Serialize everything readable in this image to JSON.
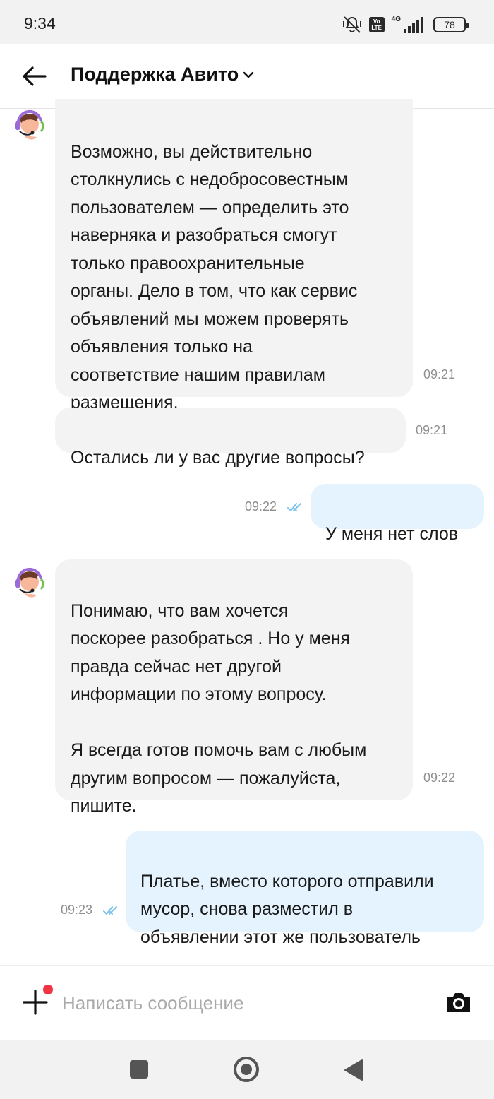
{
  "status_bar": {
    "time": "9:34",
    "network": "4G",
    "volte": "Vo\nLTE",
    "battery": "78",
    "icons": [
      "mute-vibrate-icon",
      "volte-icon",
      "signal-icon",
      "battery-icon"
    ]
  },
  "header": {
    "title": "Поддержка Авито",
    "back_icon": "arrow-left-icon",
    "dropdown_icon": "chevron-down-icon"
  },
  "messages": [
    {
      "direction": "incoming",
      "text": "Возможно, вы действительно\nстолкнулись с недобросовестным\nпользователем — определить это\nнаверняка и разобраться смогут\nтолько правоохранительные\nорганы. Дело в том, что как сервис\nобъявлений мы можем проверять\nобъявления  только на\nсоответствие нашим правилам\nразмещения.",
      "time": "09:21"
    },
    {
      "direction": "incoming",
      "text": "Остались ли у вас другие вопросы?",
      "time": "09:21"
    },
    {
      "direction": "outgoing",
      "text": "У меня нет слов",
      "time": "09:22",
      "status": "read"
    },
    {
      "direction": "incoming",
      "text": "Понимаю, что вам хочется\nпоскорее разобраться . Но у меня\nправда сейчас нет другой\nинформации по этому вопросу.\n\nЯ всегда готов помочь вам с любым\nдругим вопросом — пожалуйста,\nпишите.",
      "time": "09:22"
    },
    {
      "direction": "outgoing",
      "text": "Платье, вместо которого отправили\nмусор, снова разместил в\nобъявлении этот же пользователь",
      "time": "09:23",
      "status": "read"
    }
  ],
  "input": {
    "placeholder": "Написать сообщение",
    "value": "",
    "add_icon": "plus-icon",
    "camera_icon": "camera-icon"
  },
  "nav": {
    "icons": [
      "recents-icon",
      "home-icon",
      "back-icon"
    ]
  },
  "colors": {
    "incoming_bubble": "#f3f3f3",
    "outgoing_bubble": "#e4f3fd",
    "read_ticks": "#7cc4ee",
    "notification_dot": "#f23545"
  }
}
